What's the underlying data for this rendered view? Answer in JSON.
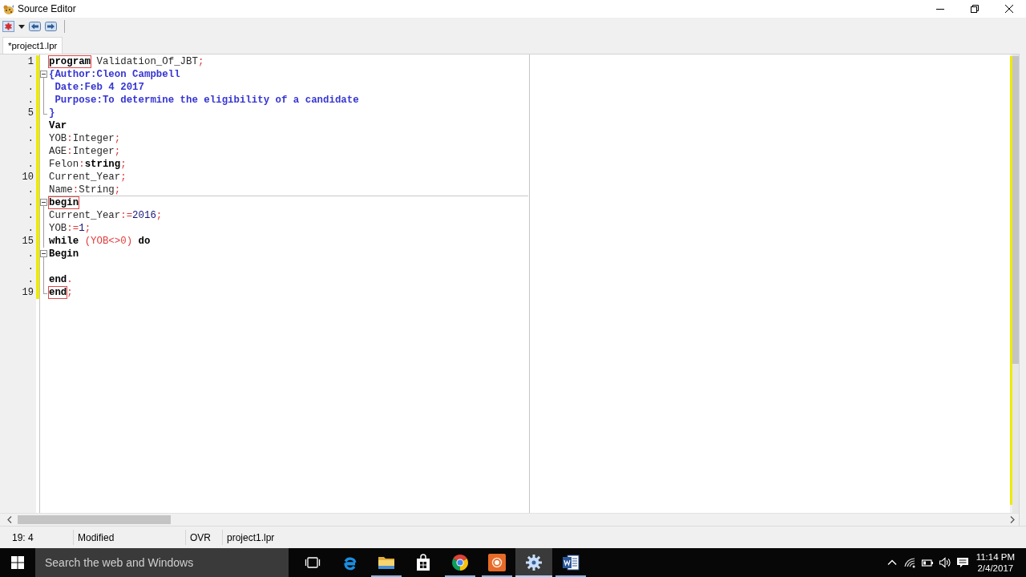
{
  "window": {
    "title": "Source Editor"
  },
  "tabs": [
    {
      "label": "*project1.lpr",
      "selected": true
    }
  ],
  "editor": {
    "lines": [
      {
        "number": "1",
        "modified": true,
        "divider": false,
        "tokens": [
          {
            "text": "program",
            "kind": "framed"
          },
          {
            "text": " Validation_Of_JBT",
            "kind": "ident"
          },
          {
            "text": ";",
            "kind": "symbol"
          }
        ]
      },
      {
        "number": ".",
        "modified": true,
        "divider": false,
        "fold": {
          "kind": "open"
        },
        "tokens": [
          {
            "text": "{Author:Cleon Campbell",
            "kind": "comment"
          }
        ]
      },
      {
        "number": ".",
        "modified": true,
        "divider": false,
        "fold": {
          "kind": "line"
        },
        "tokens": [
          {
            "text": " Date:Feb 4 2017",
            "kind": "comment"
          }
        ]
      },
      {
        "number": ".",
        "modified": true,
        "divider": false,
        "fold": {
          "kind": "line"
        },
        "tokens": [
          {
            "text": " Purpose:To determine the eligibility of a candidate",
            "kind": "comment"
          }
        ]
      },
      {
        "number": "5",
        "modified": true,
        "divider": false,
        "fold": {
          "kind": "end"
        },
        "tokens": [
          {
            "text": "}",
            "kind": "comment"
          }
        ]
      },
      {
        "number": ".",
        "modified": true,
        "divider": false,
        "tokens": [
          {
            "text": "Var",
            "kind": "keyword"
          }
        ]
      },
      {
        "number": ".",
        "modified": true,
        "divider": false,
        "tokens": [
          {
            "text": "YOB",
            "kind": "ident"
          },
          {
            "text": ":",
            "kind": "symbol"
          },
          {
            "text": "Integer",
            "kind": "ident"
          },
          {
            "text": ";",
            "kind": "symbol"
          }
        ]
      },
      {
        "number": ".",
        "modified": true,
        "divider": false,
        "tokens": [
          {
            "text": "AGE",
            "kind": "ident"
          },
          {
            "text": ":",
            "kind": "symbol"
          },
          {
            "text": "Integer",
            "kind": "ident"
          },
          {
            "text": ";",
            "kind": "symbol"
          }
        ]
      },
      {
        "number": ".",
        "modified": true,
        "divider": false,
        "tokens": [
          {
            "text": "Felon",
            "kind": "ident"
          },
          {
            "text": ":",
            "kind": "symbol"
          },
          {
            "text": "string",
            "kind": "keyword"
          },
          {
            "text": ";",
            "kind": "symbol"
          }
        ]
      },
      {
        "number": "10",
        "modified": true,
        "divider": false,
        "tokens": [
          {
            "text": "Current_Year",
            "kind": "ident"
          },
          {
            "text": ";",
            "kind": "symbol"
          }
        ]
      },
      {
        "number": ".",
        "modified": true,
        "divider": true,
        "tokens": [
          {
            "text": "Name",
            "kind": "ident"
          },
          {
            "text": ":",
            "kind": "symbol"
          },
          {
            "text": "String",
            "kind": "ident"
          },
          {
            "text": ";",
            "kind": "symbol"
          }
        ]
      },
      {
        "number": ".",
        "modified": true,
        "divider": false,
        "fold": {
          "kind": "open"
        },
        "tokens": [
          {
            "text": "begin",
            "kind": "framed"
          }
        ]
      },
      {
        "number": ".",
        "modified": true,
        "divider": false,
        "fold": {
          "kind": "line"
        },
        "tokens": [
          {
            "text": "Current_Year",
            "kind": "ident"
          },
          {
            "text": ":=",
            "kind": "symbol"
          },
          {
            "text": "2016",
            "kind": "number"
          },
          {
            "text": ";",
            "kind": "symbol"
          }
        ]
      },
      {
        "number": ".",
        "modified": true,
        "divider": false,
        "fold": {
          "kind": "line"
        },
        "tokens": [
          {
            "text": "YOB",
            "kind": "ident"
          },
          {
            "text": ":=",
            "kind": "symbol"
          },
          {
            "text": "1",
            "kind": "number"
          },
          {
            "text": ";",
            "kind": "symbol"
          }
        ]
      },
      {
        "number": "15",
        "modified": true,
        "divider": false,
        "fold": {
          "kind": "line"
        },
        "tokens": [
          {
            "text": "while ",
            "kind": "keyword"
          },
          {
            "text": "(YOB<>0)",
            "kind": "symbol"
          },
          {
            "text": " do",
            "kind": "keyword"
          }
        ]
      },
      {
        "number": ".",
        "modified": true,
        "divider": false,
        "fold": {
          "kind": "open"
        },
        "tokens": [
          {
            "text": "Begin",
            "kind": "keyword"
          }
        ]
      },
      {
        "number": ".",
        "modified": true,
        "divider": false,
        "fold": {
          "kind": "line"
        }
      },
      {
        "number": ".",
        "modified": true,
        "divider": false,
        "fold": {
          "kind": "line"
        },
        "tokens": [
          {
            "text": "end",
            "kind": "keyword"
          },
          {
            "text": ".",
            "kind": "symbol"
          }
        ]
      },
      {
        "number": "19",
        "modified": true,
        "divider": false,
        "fold": {
          "kind": "end"
        },
        "tokens": [
          {
            "text": "end",
            "kind": "framed"
          },
          {
            "text": ";",
            "kind": "symbol"
          }
        ]
      }
    ]
  },
  "status_bar": {
    "panels": [
      "19: 4",
      "Modified",
      "OVR",
      "project1.lpr"
    ]
  },
  "taskbar": {
    "search": {
      "placeholder": "Search the web and Windows"
    },
    "apps": [
      {
        "kind": "browser",
        "running": false,
        "selected": false
      },
      {
        "kind": "folder",
        "running": true,
        "selected": false
      },
      {
        "kind": "store",
        "running": false,
        "selected": false
      },
      {
        "kind": "wheel",
        "running": true,
        "selected": false
      },
      {
        "kind": "record",
        "running": true,
        "selected": false
      },
      {
        "kind": "ide",
        "running": true,
        "selected": true
      },
      {
        "kind": "writer",
        "running": true,
        "selected": false
      }
    ],
    "clock": {
      "time": "11:14 PM",
      "date": "2/4/2017"
    }
  }
}
